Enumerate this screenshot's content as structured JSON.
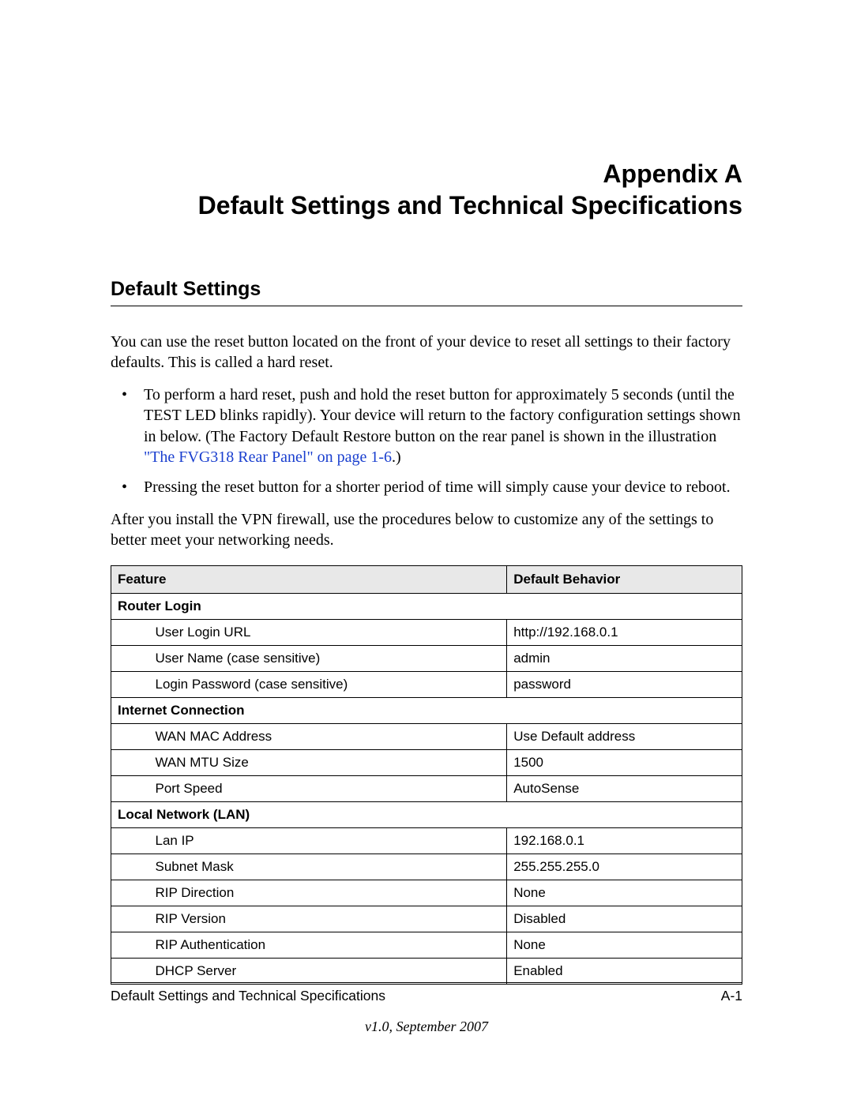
{
  "title": {
    "line1": "Appendix A",
    "line2": "Default Settings and Technical Specifications"
  },
  "section_heading": "Default Settings",
  "intro_para": "You can use the reset button located on the front of your device to reset all settings to their factory defaults. This is called a hard reset.",
  "bullets": [
    {
      "text_before_link": "To perform a hard reset, push and hold the reset button for approximately 5 seconds (until the TEST LED blinks rapidly). Your device will return to the factory configuration settings shown in below. (The Factory Default Restore button on the rear panel is shown in the illustration ",
      "link_text": "\"The FVG318 Rear Panel\" on page 1-6",
      "text_after_link": ".)"
    },
    {
      "text_before_link": "Pressing the reset button for a shorter period of time will simply cause your device to reboot.",
      "link_text": "",
      "text_after_link": ""
    }
  ],
  "post_bullets_para": "After you install the VPN firewall, use the procedures below to customize any of the settings to better meet your networking needs.",
  "table": {
    "headers": {
      "feature": "Feature",
      "behavior": "Default Behavior"
    },
    "groups": [
      {
        "label": "Router Login",
        "rows": [
          {
            "feature": "User Login URL",
            "behavior": "http://192.168.0.1"
          },
          {
            "feature": "User Name (case sensitive)",
            "behavior": "admin"
          },
          {
            "feature": "Login Password (case sensitive)",
            "behavior": "password"
          }
        ]
      },
      {
        "label": "Internet Connection",
        "rows": [
          {
            "feature": "WAN MAC Address",
            "behavior": "Use Default address"
          },
          {
            "feature": "WAN MTU Size",
            "behavior": "1500"
          },
          {
            "feature": "Port Speed",
            "behavior": "AutoSense"
          }
        ]
      },
      {
        "label": "Local Network (LAN)",
        "rows": [
          {
            "feature": "Lan IP",
            "behavior": "192.168.0.1"
          },
          {
            "feature": "Subnet Mask",
            "behavior": "255.255.255.0"
          },
          {
            "feature": "RIP Direction",
            "behavior": "None"
          },
          {
            "feature": "RIP Version",
            "behavior": "Disabled"
          },
          {
            "feature": "RIP Authentication",
            "behavior": "None"
          },
          {
            "feature": "DHCP Server",
            "behavior": "Enabled"
          }
        ]
      }
    ]
  },
  "footer": {
    "left": "Default Settings and Technical Specifications",
    "right": "A-1",
    "version": "v1.0, September 2007"
  }
}
